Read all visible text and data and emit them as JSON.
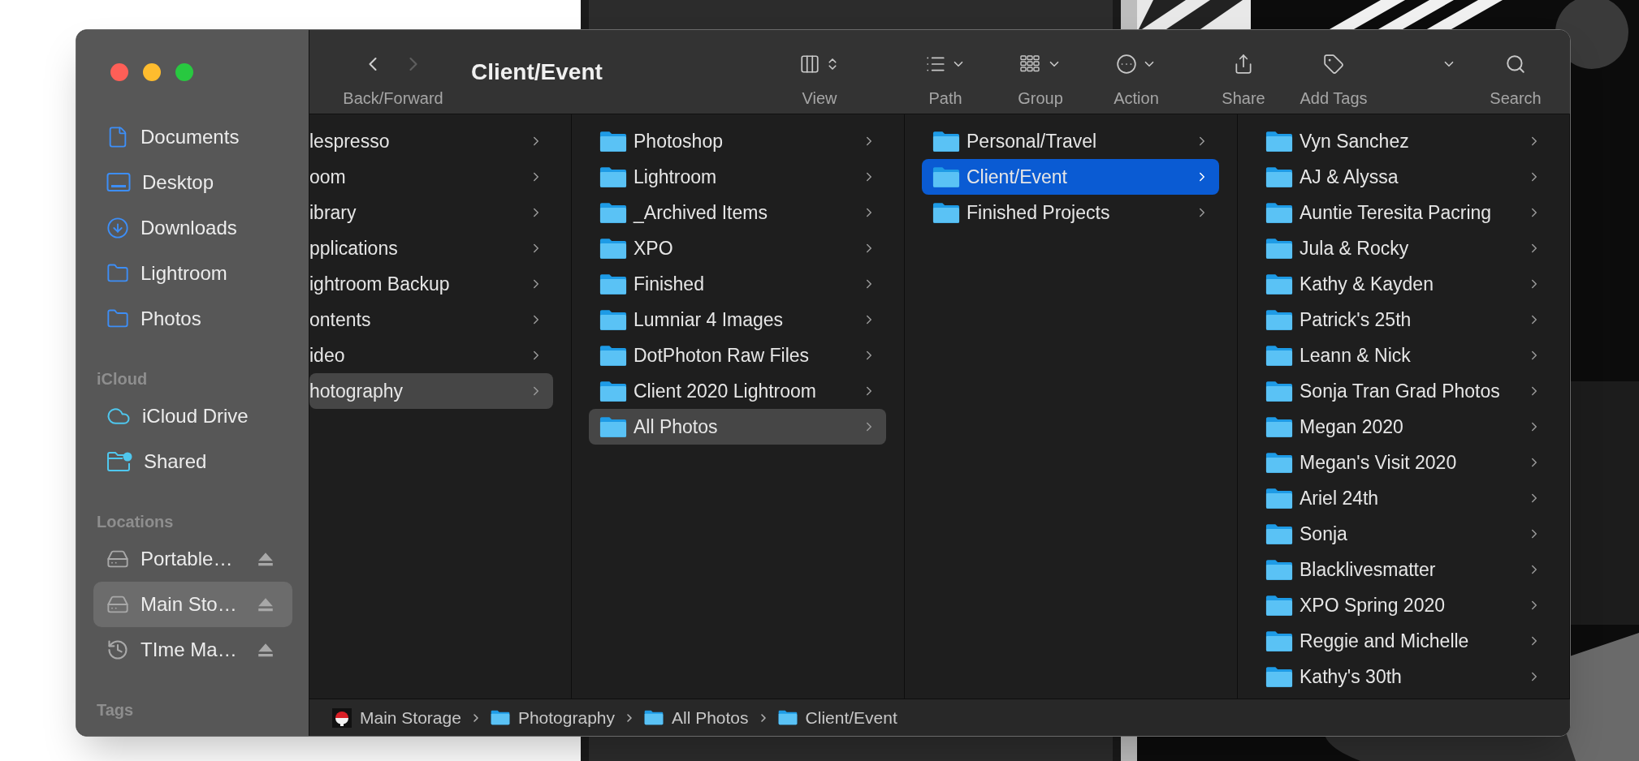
{
  "window": {
    "title": "Client/Event"
  },
  "navigation": {
    "label": "Back/Forward",
    "back_enabled": true,
    "forward_enabled": false
  },
  "toolbar": [
    {
      "kind": "view",
      "label": "View"
    },
    {
      "kind": "path",
      "label": "Path"
    },
    {
      "kind": "group",
      "label": "Group"
    },
    {
      "kind": "action",
      "label": "Action"
    },
    {
      "kind": "share",
      "label": "Share"
    },
    {
      "kind": "tags",
      "label": "Add Tags"
    },
    {
      "kind": "more"
    },
    {
      "kind": "search",
      "label": "Search"
    }
  ],
  "sidebar": [
    {
      "items": [
        {
          "kind": "document",
          "label": "Documents",
          "selected": false
        },
        {
          "kind": "desktop",
          "label": "Desktop",
          "selected": false
        },
        {
          "kind": "downloads",
          "label": "Downloads",
          "selected": false
        },
        {
          "kind": "folder",
          "label": "Lightroom",
          "selected": false
        },
        {
          "kind": "folder",
          "label": "Photos",
          "selected": false
        }
      ]
    },
    {
      "header": "iCloud",
      "items": [
        {
          "kind": "cloud",
          "label": "iCloud Drive",
          "selected": false
        },
        {
          "kind": "shared",
          "label": "Shared",
          "selected": false
        }
      ]
    },
    {
      "header": "Locations",
      "items": [
        {
          "kind": "drive",
          "label": "Portable…",
          "selected": false,
          "ejectable": true
        },
        {
          "kind": "drive",
          "label": "Main Sto…",
          "selected": true,
          "ejectable": true
        },
        {
          "kind": "timemachine",
          "label": "TIme Ma…",
          "selected": false,
          "ejectable": true
        }
      ]
    },
    {
      "header": "Tags"
    }
  ],
  "columns": [
    {
      "kind": "scrolled",
      "focused": false,
      "rows": [
        {
          "label": "lespresso",
          "selected": false
        },
        {
          "label": "oom",
          "selected": false
        },
        {
          "label": "ibrary",
          "selected": false
        },
        {
          "label": "pplications",
          "selected": false
        },
        {
          "label": "ightroom Backup",
          "selected": false
        },
        {
          "label": "ontents",
          "selected": false
        },
        {
          "label": "ideo",
          "selected": false
        },
        {
          "label": "hotography",
          "selected": true
        }
      ]
    },
    {
      "kind": "full",
      "focused": false,
      "rows": [
        {
          "label": "Photoshop",
          "selected": false
        },
        {
          "label": "Lightroom",
          "selected": false
        },
        {
          "label": "_Archived Items",
          "selected": false
        },
        {
          "label": "XPO",
          "selected": false
        },
        {
          "label": "Finished",
          "selected": false
        },
        {
          "label": "Lumniar 4 Images",
          "selected": false
        },
        {
          "label": "DotPhoton Raw Files",
          "selected": false
        },
        {
          "label": "Client 2020 Lightroom",
          "selected": false
        },
        {
          "label": "All Photos",
          "selected": true
        }
      ]
    },
    {
      "kind": "full",
      "focused": true,
      "rows": [
        {
          "label": "Personal/Travel",
          "selected": false
        },
        {
          "label": "Client/Event",
          "selected": true
        },
        {
          "label": "Finished Projects",
          "selected": false
        }
      ]
    },
    {
      "kind": "full",
      "rows": [
        {
          "label": "Vyn Sanchez",
          "selected": false
        },
        {
          "label": "AJ & Alyssa",
          "selected": false
        },
        {
          "label": "Auntie Teresita Pacring",
          "selected": false
        },
        {
          "label": "Jula & Rocky",
          "selected": false
        },
        {
          "label": "Kathy & Kayden",
          "selected": false
        },
        {
          "label": "Patrick's 25th",
          "selected": false
        },
        {
          "label": "Leann & Nick",
          "selected": false
        },
        {
          "label": "Sonja Tran Grad Photos",
          "selected": false
        },
        {
          "label": "Megan 2020",
          "selected": false
        },
        {
          "label": "Megan's Visit 2020",
          "selected": false
        },
        {
          "label": "Ariel 24th",
          "selected": false
        },
        {
          "label": "Sonja",
          "selected": false
        },
        {
          "label": "Blacklivesmatter",
          "selected": false
        },
        {
          "label": "XPO Spring 2020",
          "selected": false
        },
        {
          "label": "Reggie and Michelle",
          "selected": false
        },
        {
          "label": "Kathy's 30th",
          "selected": false
        }
      ]
    }
  ],
  "path_bar": [
    {
      "kind": "volume",
      "label": "Main Storage"
    },
    {
      "kind": "folder",
      "label": "Photography"
    },
    {
      "kind": "folder",
      "label": "All Photos"
    },
    {
      "kind": "folder",
      "label": "Client/Event"
    }
  ]
}
